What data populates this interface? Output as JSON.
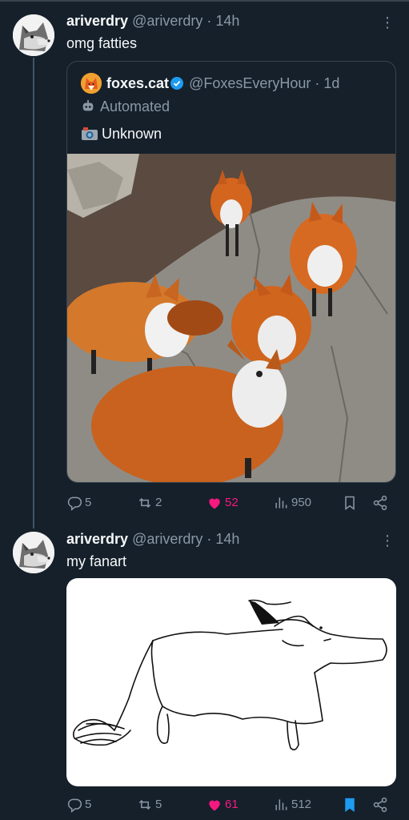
{
  "tweet1": {
    "display_name": "ariverdry",
    "handle": "@ariverdry",
    "time": "· 14h",
    "text": "omg fatties",
    "quote": {
      "display_name": "foxes.cat",
      "handle": "@FoxesEveryHour",
      "time": "· 1d",
      "automated_label": "Automated",
      "text": "Unknown",
      "image_icon": "camera-emoji"
    },
    "actions": {
      "replies": "5",
      "reposts": "2",
      "likes": "52",
      "views": "950",
      "liked": true,
      "bookmarked": false
    }
  },
  "tweet2": {
    "display_name": "ariverdry",
    "handle": "@ariverdry",
    "time": "· 14h",
    "text": "my fanart",
    "actions": {
      "replies": "5",
      "reposts": "5",
      "likes": "61",
      "views": "512",
      "liked": true,
      "bookmarked": true
    }
  },
  "icons": {
    "more": "more-vertical-icon",
    "reply": "reply-icon",
    "repost": "repost-icon",
    "like": "heart-icon",
    "views": "views-icon",
    "bookmark": "bookmark-icon",
    "share": "share-icon",
    "verified": "verified-badge-icon",
    "automated": "robot-icon"
  },
  "colors": {
    "background": "#15202b",
    "text": "#f7f9f9",
    "muted": "#8b98a5",
    "like": "#f91880",
    "accent": "#1d9bf0",
    "border": "#38444d"
  }
}
